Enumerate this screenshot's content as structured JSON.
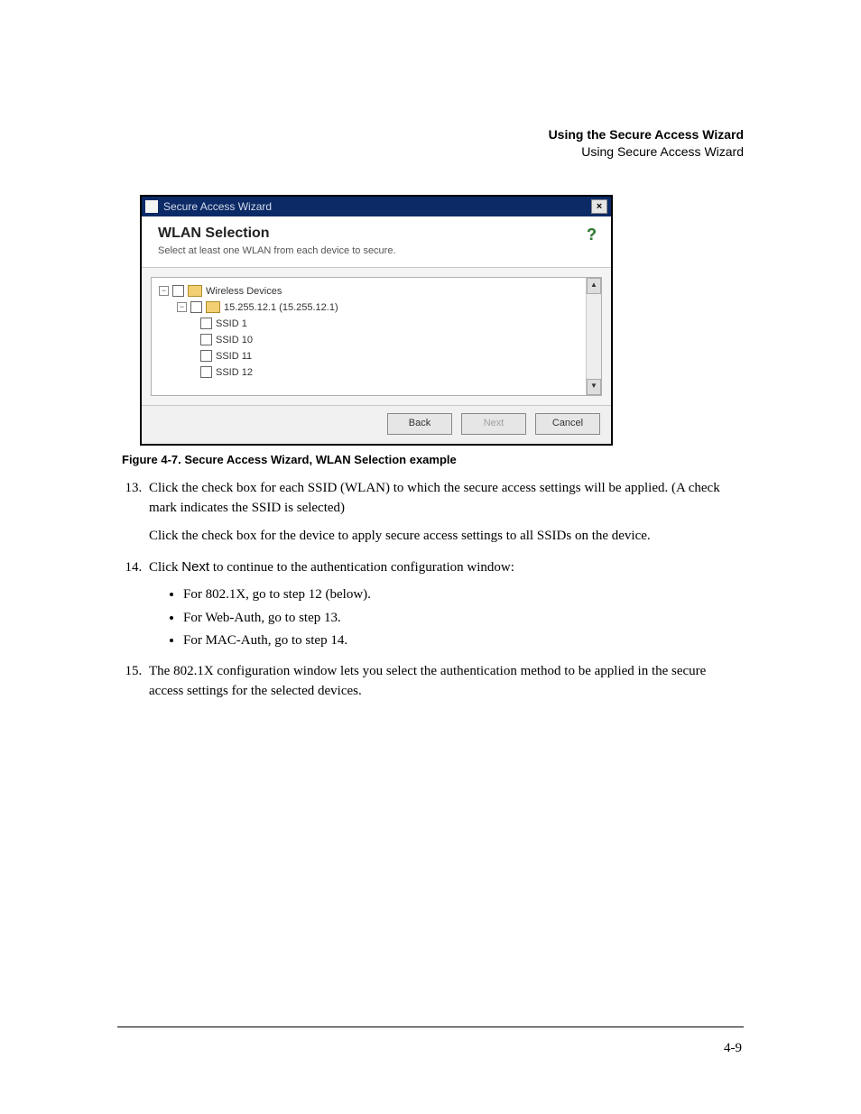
{
  "header": {
    "title": "Using the Secure Access Wizard",
    "subtitle": "Using Secure Access Wizard"
  },
  "dialog": {
    "window_title": "Secure Access Wizard",
    "close_glyph": "×",
    "heading": "WLAN Selection",
    "subheading": "Select at least one WLAN from each device to secure.",
    "help_glyph": "?",
    "tree": {
      "root_label": "Wireless Devices",
      "device_label": "15.255.12.1  (15.255.12.1)",
      "ssids": [
        "SSID 1",
        "SSID 10",
        "SSID 11",
        "SSID 12"
      ]
    },
    "scroll_up": "▲",
    "scroll_down": "▼",
    "buttons": {
      "back": "Back",
      "next": "Next",
      "cancel": "Cancel"
    }
  },
  "figure_caption": "Figure 4-7. Secure Access Wizard, WLAN Selection example",
  "steps": {
    "s13_a": "Click the check box for each SSID (WLAN) to which the secure access settings will be applied. (A check mark indicates the SSID is selected)",
    "s13_b": "Click the check box for the device to apply secure access settings to all SSIDs on the device.",
    "s14_lead_a": "Click ",
    "s14_next_word": "Next",
    "s14_lead_b": " to continue to the authentication configuration window:",
    "s14_bullets": [
      "For 802.1X, go to step 12 (below).",
      "For Web-Auth, go to step 13.",
      "For MAC-Auth, go to step 14."
    ],
    "s15": "The 802.1X configuration window lets you select the authentication method to be applied in the secure access settings for the selected devices."
  },
  "page_number": "4-9"
}
